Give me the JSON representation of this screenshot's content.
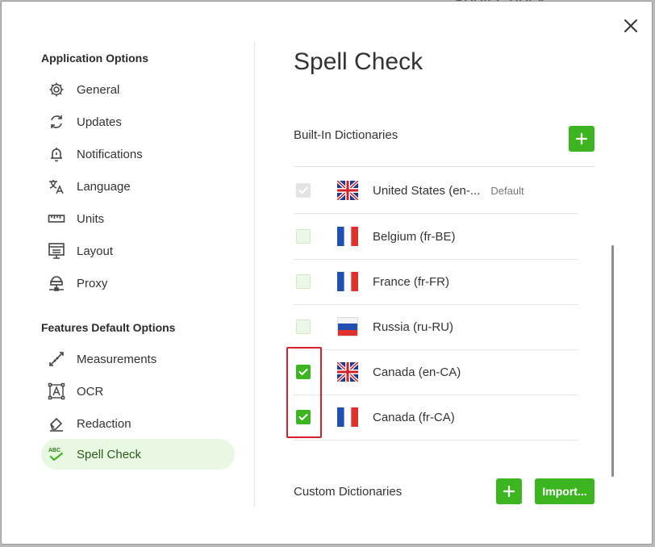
{
  "backdrop_text": "Spell Check",
  "sidebar": {
    "application_section": "Application Options",
    "application_items": [
      {
        "label": "General",
        "icon": "gear-icon"
      },
      {
        "label": "Updates",
        "icon": "sync-icon"
      },
      {
        "label": "Notifications",
        "icon": "bell-icon"
      },
      {
        "label": "Language",
        "icon": "translate-icon"
      },
      {
        "label": "Units",
        "icon": "ruler-icon"
      },
      {
        "label": "Layout",
        "icon": "layout-icon"
      },
      {
        "label": "Proxy",
        "icon": "network-icon"
      }
    ],
    "features_section": "Features Default Options",
    "features_items": [
      {
        "label": "Measurements",
        "icon": "measure-icon"
      },
      {
        "label": "OCR",
        "icon": "ocr-icon"
      },
      {
        "label": "Redaction",
        "icon": "eraser-icon"
      },
      {
        "label": "Spell Check",
        "icon": "spellcheck-icon",
        "active": true
      }
    ]
  },
  "main": {
    "title": "Spell Check",
    "built_in_heading": "Built-In Dictionaries",
    "custom_heading": "Custom Dictionaries",
    "import_label": "Import...",
    "dictionaries": [
      {
        "label": "United States (en-...",
        "badge": "Default",
        "state": "disabled-checked",
        "flag": "uk-flag-icon"
      },
      {
        "label": "Belgium (fr-BE)",
        "state": "unchecked",
        "flag": "france-flag-icon"
      },
      {
        "label": "France (fr-FR)",
        "state": "unchecked",
        "flag": "france-flag-icon"
      },
      {
        "label": "Russia (ru-RU)",
        "state": "unchecked",
        "flag": "russia-flag-icon"
      },
      {
        "label": "Canada (en-CA)",
        "state": "checked",
        "flag": "uk-flag-icon"
      },
      {
        "label": "Canada (fr-CA)",
        "state": "checked",
        "flag": "france-flag-icon"
      }
    ]
  },
  "colors": {
    "accent": "#3cb521",
    "active_nav_bg": "#e9f8e3",
    "highlight": "#d8202a"
  }
}
